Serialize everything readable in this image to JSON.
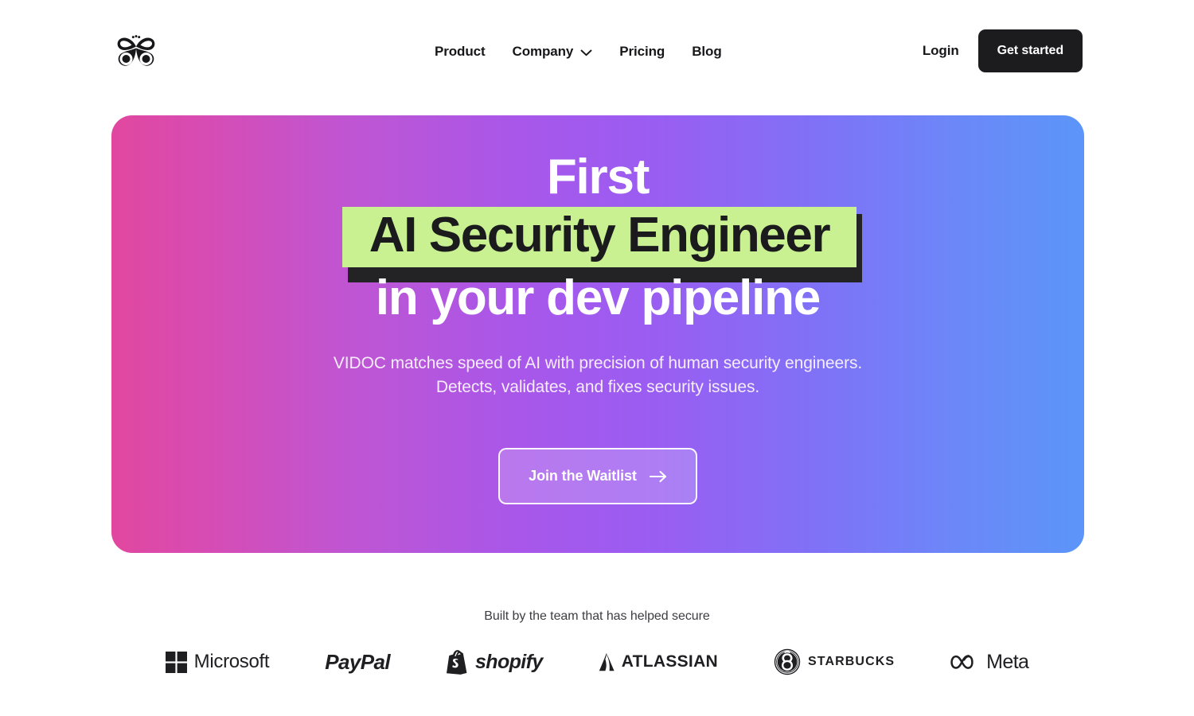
{
  "header": {
    "logo_icon": "butterfly-logo-icon",
    "nav": [
      {
        "label": "Product",
        "has_caret": false
      },
      {
        "label": "Company",
        "has_caret": true
      },
      {
        "label": "Pricing",
        "has_caret": false
      },
      {
        "label": "Blog",
        "has_caret": false
      }
    ],
    "login_label": "Login",
    "get_started_label": "Get started",
    "caret_icon": "chevron-down-icon"
  },
  "hero": {
    "headline_line1": "First",
    "headline_highlight": "AI Security Engineer",
    "headline_line3": "in your dev pipeline",
    "subtitle_line1": "VIDOC matches speed of AI with precision of human security engineers.",
    "subtitle_line2": "Detects, validates, and fixes security issues.",
    "cta_label": "Join the Waitlist",
    "cta_icon": "arrow-right-icon",
    "colors": {
      "gradient_start": "#e1479f",
      "gradient_mid": "#a857ea",
      "gradient_end": "#5b95f9",
      "highlight_bg": "#c9f192",
      "highlight_text": "#1b1b1e",
      "highlight_shadow": "#232326"
    }
  },
  "social_proof": {
    "caption": "Built by the team that has helped secure",
    "brands": [
      {
        "name": "Microsoft",
        "icon": "microsoft-squares-icon"
      },
      {
        "name": "PayPal",
        "icon": "paypal-wordmark-icon"
      },
      {
        "name": "shopify",
        "icon": "shopify-bag-icon"
      },
      {
        "name": "ATLASSIAN",
        "icon": "atlassian-mark-icon"
      },
      {
        "name": "STARBUCKS",
        "icon": "starbucks-siren-icon"
      },
      {
        "name": "Meta",
        "icon": "meta-infinity-icon"
      }
    ]
  }
}
